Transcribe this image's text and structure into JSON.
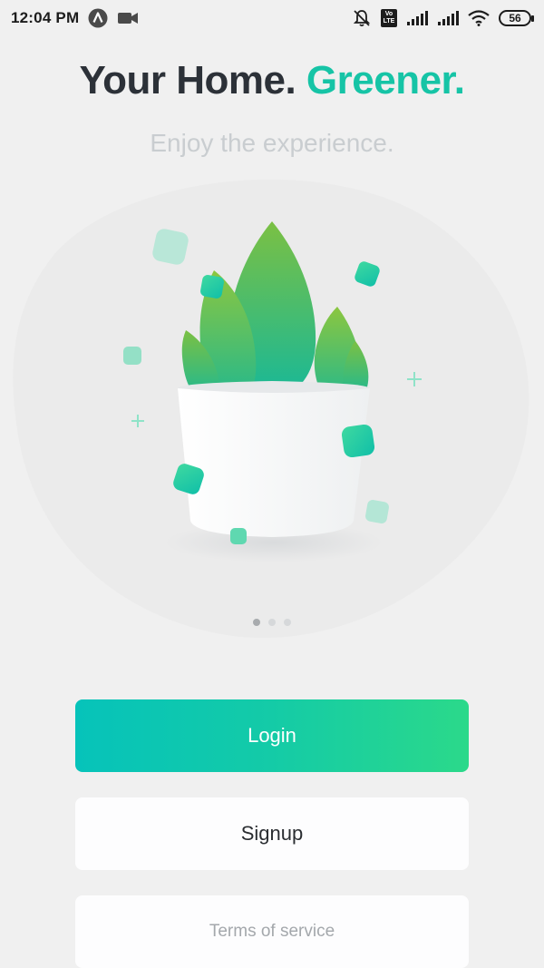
{
  "status_bar": {
    "time": "12:04 PM",
    "volte_top": "Vo",
    "volte_bottom": "LTE",
    "battery": "56"
  },
  "header": {
    "title_part1": "Your Home.",
    "title_part2": "Greener.",
    "subtitle": "Enjoy the experience."
  },
  "pager": {
    "count": 3,
    "active_index": 0
  },
  "actions": {
    "login_label": "Login",
    "signup_label": "Signup",
    "terms_label": "Terms of service"
  },
  "colors": {
    "accent": "#16c4a6",
    "login_gradient_start": "#06c3ba",
    "login_gradient_end": "#2bd98a",
    "background": "#f0f0f0"
  },
  "icons": [
    "app-logo-icon",
    "video-camera-icon",
    "notifications-muted-icon",
    "volte-icon",
    "signal-icon",
    "wifi-icon",
    "battery-icon",
    "plant-icon"
  ]
}
